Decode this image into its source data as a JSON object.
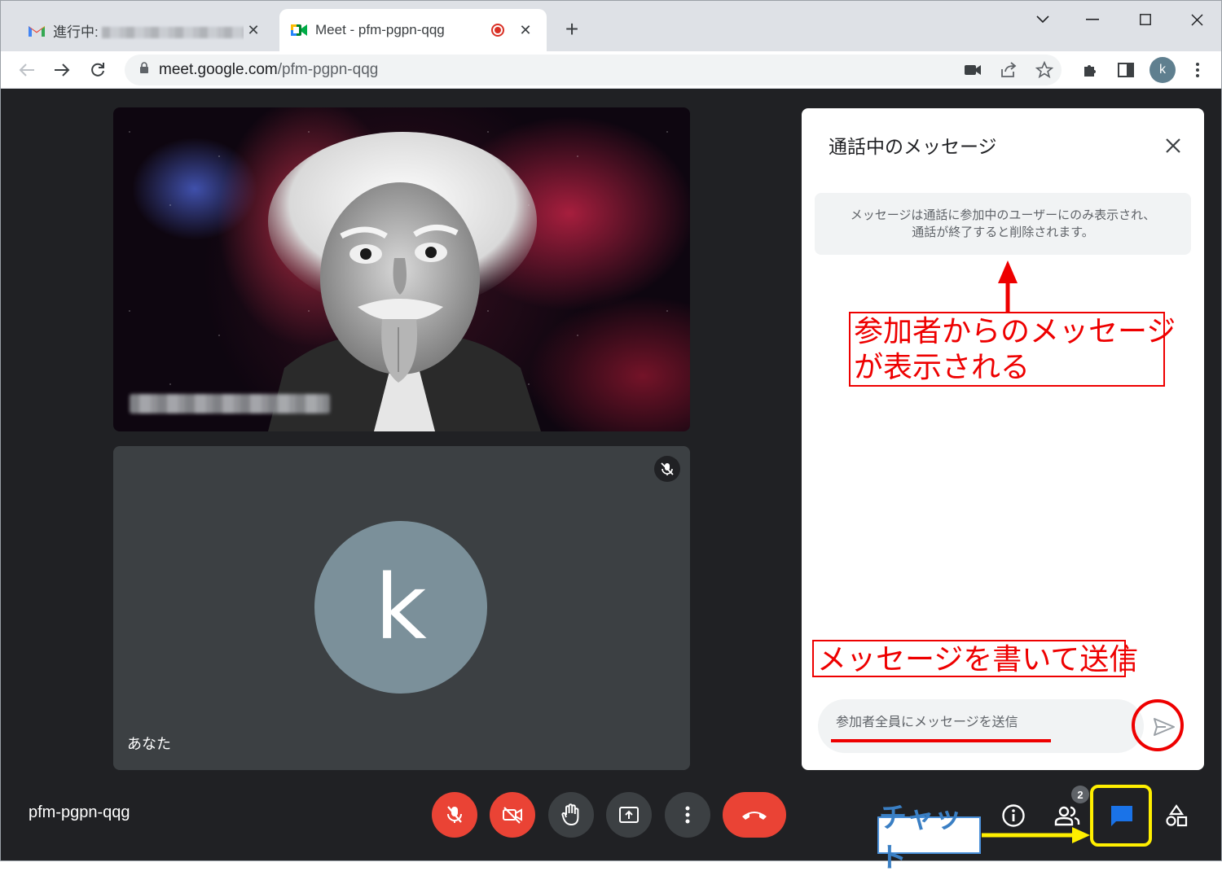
{
  "browser": {
    "tabs": [
      {
        "title": "進行中:",
        "active": false
      },
      {
        "title": "Meet - pfm-pgpn-qqg",
        "active": true
      }
    ],
    "url_host": "meet.google.com",
    "url_path": "/pfm-pgpn-qqg",
    "profile_initial": "k"
  },
  "meet": {
    "meeting_code": "pfm-pgpn-qqg",
    "self_tile": {
      "avatar_initial": "k",
      "name": "あなた"
    },
    "participants_count": "2",
    "chat": {
      "title": "通話中のメッセージ",
      "notice_line1": "メッセージは通話に参加中のユーザーにのみ表示され、",
      "notice_line2": "通話が終了すると削除されます。",
      "input_placeholder": "参加者全員にメッセージを送信"
    }
  },
  "annotations": {
    "messages_shown_line1": "参加者からのメッセージ",
    "messages_shown_line2": "が表示される",
    "write_and_send": "メッセージを書いて送信",
    "chat_label": "チャット"
  },
  "colors": {
    "meet_bg": "#202124",
    "red_button": "#ea4335",
    "annotation_red": "#e00000",
    "annotation_yellow": "#ffef00",
    "chat_blue": "#1a73e8"
  }
}
